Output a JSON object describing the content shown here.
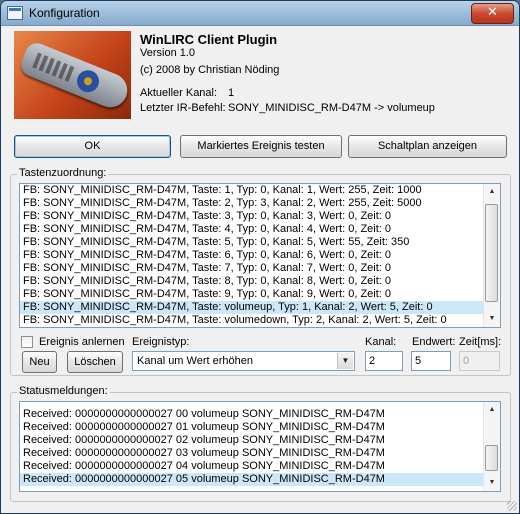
{
  "window": {
    "title": "Konfiguration",
    "close_glyph": "✕"
  },
  "header": {
    "plugin_title": "WinLIRC Client Plugin",
    "version": "Version 1.0",
    "copyright": "(c) 2008 by Christian Nöding",
    "channel_label": "Aktueller Kanal:",
    "channel_value": "1",
    "last_ir_label": "Letzter IR-Befehl:",
    "last_ir_value": "SONY_MINIDISC_RM-D47M -> volumeup",
    "logo_icon": "remote-control-image"
  },
  "buttons": {
    "ok": "OK",
    "test": "Markiertes Ereignis testen",
    "schematic": "Schaltplan anzeigen"
  },
  "mapping": {
    "group_label": "Tastenzuordnung:",
    "rows": [
      "FB: SONY_MINIDISC_RM-D47M, Taste: 1, Typ: 0, Kanal: 1, Wert: 255, Zeit: 1000",
      "FB: SONY_MINIDISC_RM-D47M, Taste: 2, Typ: 3, Kanal: 2, Wert: 255, Zeit: 5000",
      "FB: SONY_MINIDISC_RM-D47M, Taste: 3, Typ: 0, Kanal: 3, Wert: 0, Zeit: 0",
      "FB: SONY_MINIDISC_RM-D47M, Taste: 4, Typ: 0, Kanal: 4, Wert: 0, Zeit: 0",
      "FB: SONY_MINIDISC_RM-D47M, Taste: 5, Typ: 0, Kanal: 5, Wert: 55, Zeit: 350",
      "FB: SONY_MINIDISC_RM-D47M, Taste: 6, Typ: 0, Kanal: 6, Wert: 0, Zeit: 0",
      "FB: SONY_MINIDISC_RM-D47M, Taste: 7, Typ: 0, Kanal: 7, Wert: 0, Zeit: 0",
      "FB: SONY_MINIDISC_RM-D47M, Taste: 8, Typ: 0, Kanal: 8, Wert: 0, Zeit: 0",
      "FB: SONY_MINIDISC_RM-D47M, Taste: 9, Typ: 0, Kanal: 9, Wert: 0, Zeit: 0",
      "FB: SONY_MINIDISC_RM-D47M, Taste: volumeup, Typ: 1, Kanal: 2, Wert: 5, Zeit: 0",
      "FB: SONY_MINIDISC_RM-D47M, Taste: volumedown, Typ: 2, Kanal: 2, Wert: 5, Zeit: 0"
    ],
    "selected_index": 9,
    "learn_label": "Ereignis anlernen",
    "learn_checked": false,
    "new_label": "Neu",
    "delete_label": "Löschen",
    "event_type_label": "Ereignistyp:",
    "event_type_value": "Kanal um Wert erhöhen",
    "channel_label": "Kanal:",
    "channel_value": "2",
    "end_value_label": "Endwert:",
    "end_value": "5",
    "time_label": "Zeit[ms]:",
    "time_value": "0"
  },
  "status": {
    "group_label": "Statusmeldungen:",
    "rows": [
      "Received: 0000000000000027 00 volumeup SONY_MINIDISC_RM-D47M",
      "Received: 0000000000000027 01 volumeup SONY_MINIDISC_RM-D47M",
      "Received: 0000000000000027 02 volumeup SONY_MINIDISC_RM-D47M",
      "Received: 0000000000000027 03 volumeup SONY_MINIDISC_RM-D47M",
      "Received: 0000000000000027 04 volumeup SONY_MINIDISC_RM-D47M",
      "Received: 0000000000000027 05 volumeup SONY_MINIDISC_RM-D47M"
    ],
    "selected_index": 5
  },
  "icons": {
    "scroll_up": "▲",
    "scroll_down": "▼",
    "dropdown": "▼"
  }
}
